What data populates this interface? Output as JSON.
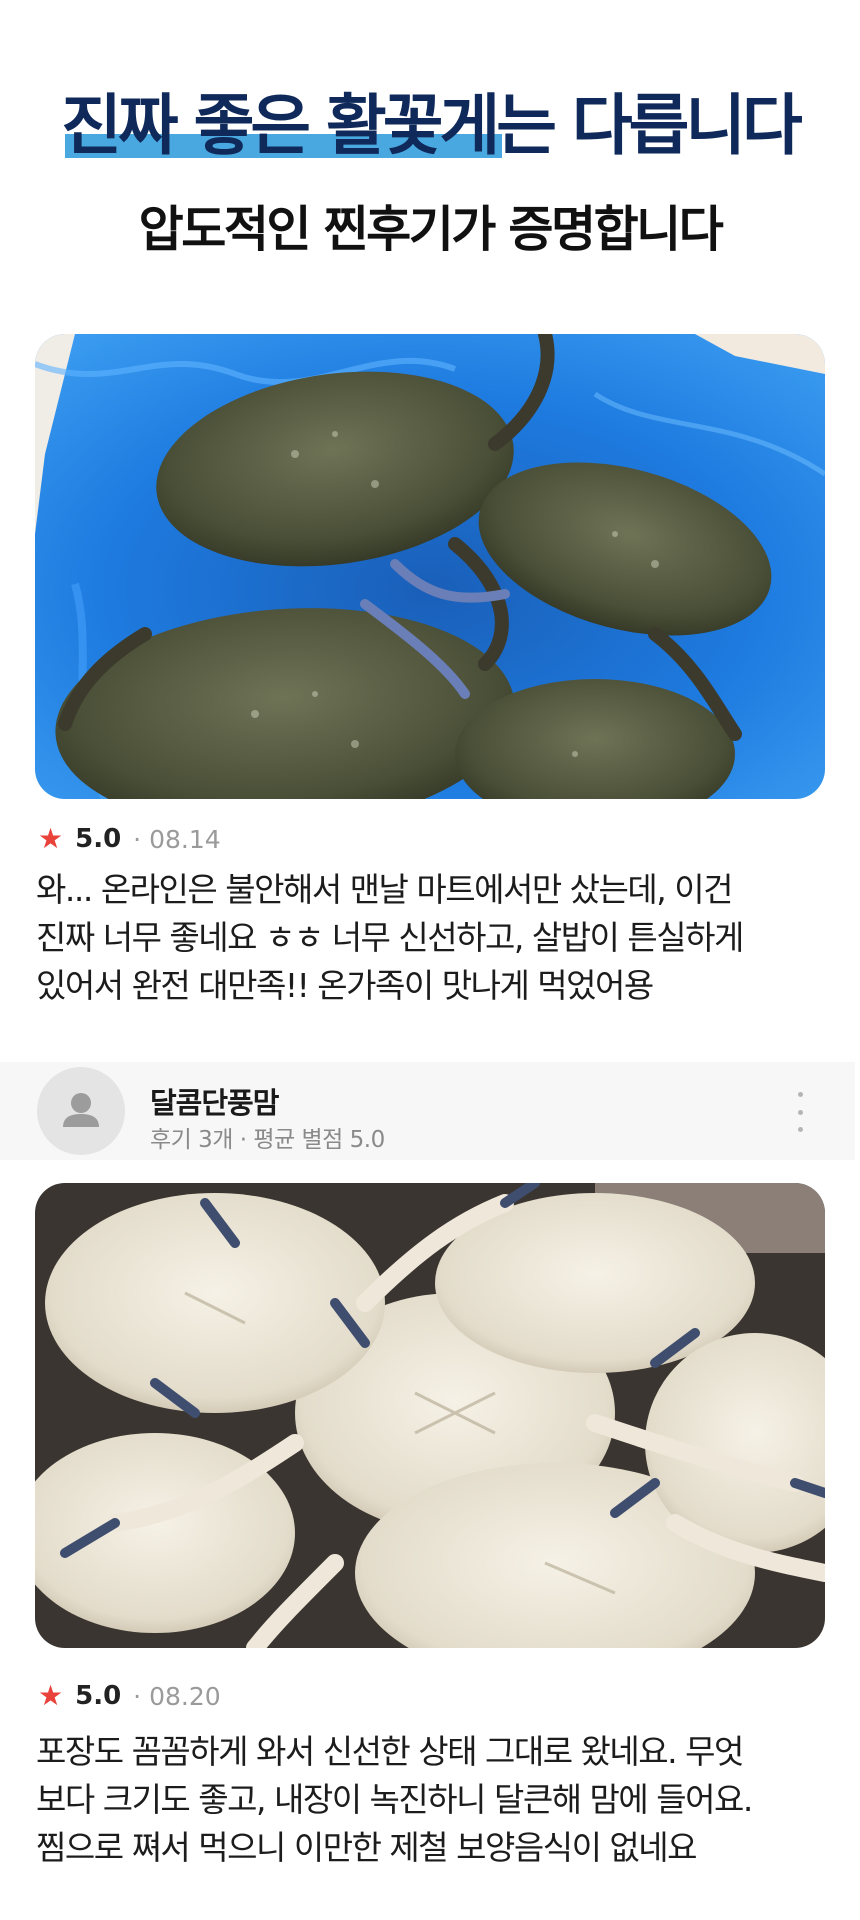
{
  "hero": {
    "headline_highlight": "진짜 좋은 활꽃게",
    "headline_rest": "는 다릅니다",
    "subline": "압도적인 찐후기가 증명합니다"
  },
  "reviews": [
    {
      "star_icon": "★",
      "rating": "5.0",
      "date": "· 08.14",
      "lines": [
        "와... 온라인은 불안해서 맨날 마트에서만 샀는데, 이건",
        "진짜 너무 좋네요 ㅎㅎ 너무 신선하고, 살밥이 튼실하게",
        "있어서 완전 대만족!! 온가족이 맛나게 먹었어용"
      ]
    },
    {
      "star_icon": "★",
      "rating": "5.0",
      "date": "· 08.20",
      "lines": [
        "포장도 꼼꼼하게 와서 신선한 상태 그대로 왔네요. 무엇",
        "보다 크기도 좋고, 내장이 녹진하니 달큰해 맘에 들어요.",
        "찜으로 쪄서 먹으니 이만한 제철 보양음식이 없네요"
      ]
    }
  ],
  "reviewer": {
    "name": "달콤단풍맘",
    "stats": "후기 3개 · 평균 별점 5.0",
    "avatar_icon": "person-icon",
    "menu_icon": "more-vertical-icon"
  },
  "colors": {
    "headline": "#0f2a5a",
    "highlight": "#4aa8e0",
    "star": "#e8423a",
    "box_liner": "#1f74d6"
  }
}
